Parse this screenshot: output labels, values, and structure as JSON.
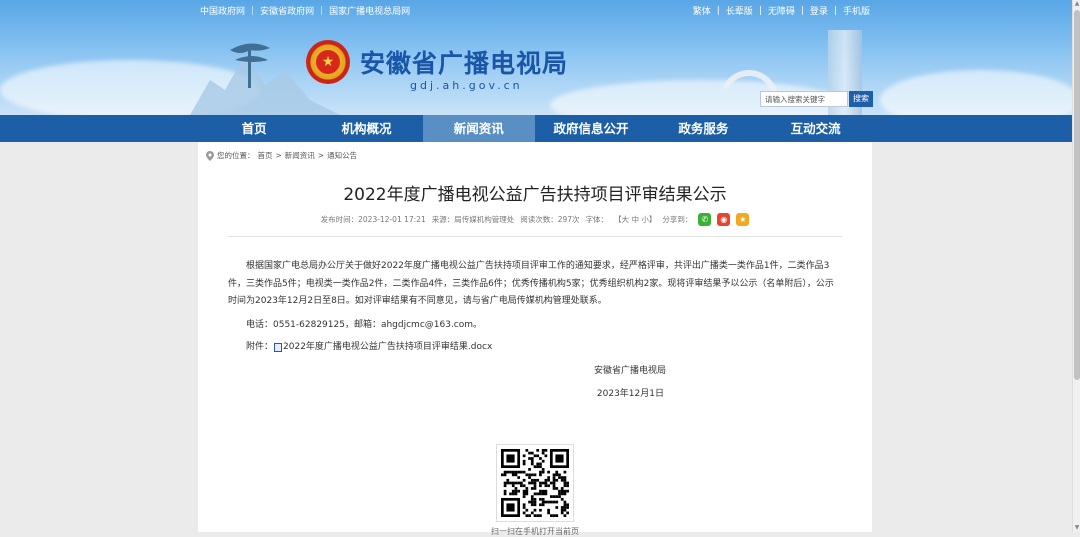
{
  "top_links_left": [
    "中国政府网",
    "安徽省政府网",
    "国家广播电视总局网"
  ],
  "top_links_right": [
    "繁体",
    "长辈版",
    "无障碍",
    "登录",
    "手机版"
  ],
  "site": {
    "title": "安徽省广播电视局",
    "domain": "gdj.ah.gov.cn",
    "search_placeholder": "请输入搜索关键字",
    "search_button": "搜索"
  },
  "nav": [
    "首页",
    "机构概况",
    "新闻资讯",
    "政府信息公开",
    "政务服务",
    "互动交流"
  ],
  "nav_active_index": 2,
  "breadcrumb": {
    "prefix": "您的位置：",
    "items": [
      "首页",
      "新闻资讯",
      "通知公告"
    ],
    "sep": ">"
  },
  "article": {
    "title": "2022年度广播电视公益广告扶持项目评审结果公示",
    "meta": {
      "publish_time": "发布时间：2023-12-01 17:21",
      "source": "来源：局传媒机构管理处",
      "views": "阅读次数：297次",
      "font_label": "字体：",
      "font_options": "【大 中 小】",
      "share_label": "分享到："
    },
    "paragraph": "根据国家广电总局办公厅关于做好2022年度广播电视公益广告扶持项目评审工作的通知要求，经严格评审，共评出广播类一类作品1件，二类作品3件，三类作品5件；电视类一类作品2件，二类作品4件，三类作品6件；优秀传播机构5家；优秀组织机构2家。现将评审结果予以公示（名单附后），公示时间为2023年12月2日至8日。如对评审结果有不同意见，请与省广电局传媒机构管理处联系。",
    "contact": "电话：0551-62829125，邮箱：ahgdjcmc@163.com。",
    "attachment_label": "附件：",
    "attachment_file": "2022年度广播电视公益广告扶持项目评审结果.docx",
    "sign_org": "安徽省广播电视局",
    "sign_date": "2023年12月1日",
    "qr_hint": "扫一扫在手机打开当前页"
  },
  "colors": {
    "nav_bg": "#1c5fa6",
    "nav_active": "#5a8fc4",
    "title_blue": "#1a56a8",
    "wechat": "#3cb034",
    "weibo": "#e6452e",
    "qzone": "#f2a921"
  }
}
